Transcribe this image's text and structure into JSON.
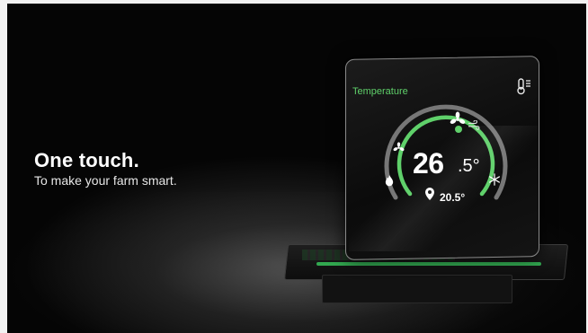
{
  "hero": {
    "headline": "One touch.",
    "subline": "To make your farm smart."
  },
  "device": {
    "screen_title": "Temperature",
    "current_temp_whole": "26",
    "current_temp_decimal": ".5°",
    "set_temp": "20.5°",
    "accent_color": "#5fd06a",
    "icons": [
      "thermometer-icon",
      "fan-icon",
      "wind-icon",
      "heat-icon",
      "flame-icon",
      "snowflake-icon",
      "location-pin-icon"
    ]
  }
}
